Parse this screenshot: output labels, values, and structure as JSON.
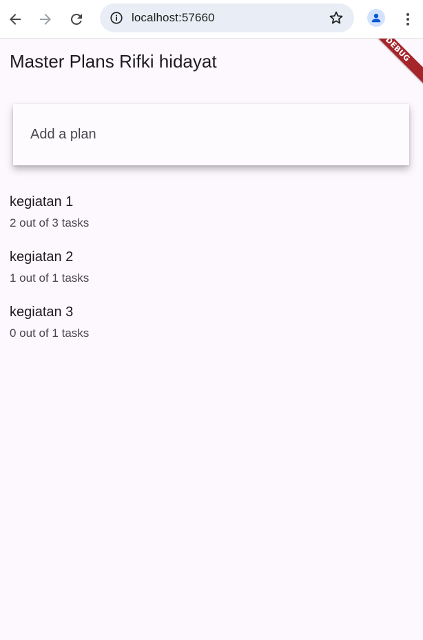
{
  "browser": {
    "url": "localhost:57660",
    "icons": {
      "back": "arrow-left-icon",
      "forward": "arrow-right-icon",
      "reload": "reload-icon",
      "info": "info-icon",
      "bookmark": "star-icon",
      "profile": "person-icon",
      "menu": "more-vert-icon"
    }
  },
  "app": {
    "title": "Master Plans Rifki hidayat",
    "debug_banner": "DEBUG",
    "input": {
      "placeholder": "Add a plan",
      "value": ""
    },
    "plans": [
      {
        "name": "kegiatan 1",
        "progress": "2 out of 3 tasks"
      },
      {
        "name": "kegiatan 2",
        "progress": "1 out of 1 tasks"
      },
      {
        "name": "kegiatan 3",
        "progress": "0 out of 1 tasks"
      }
    ]
  },
  "colors": {
    "background": "#fdf7fe",
    "debug_ribbon": "#a5252a",
    "profile_bg": "#d3e3fd",
    "profile_fg": "#0b57d0"
  }
}
